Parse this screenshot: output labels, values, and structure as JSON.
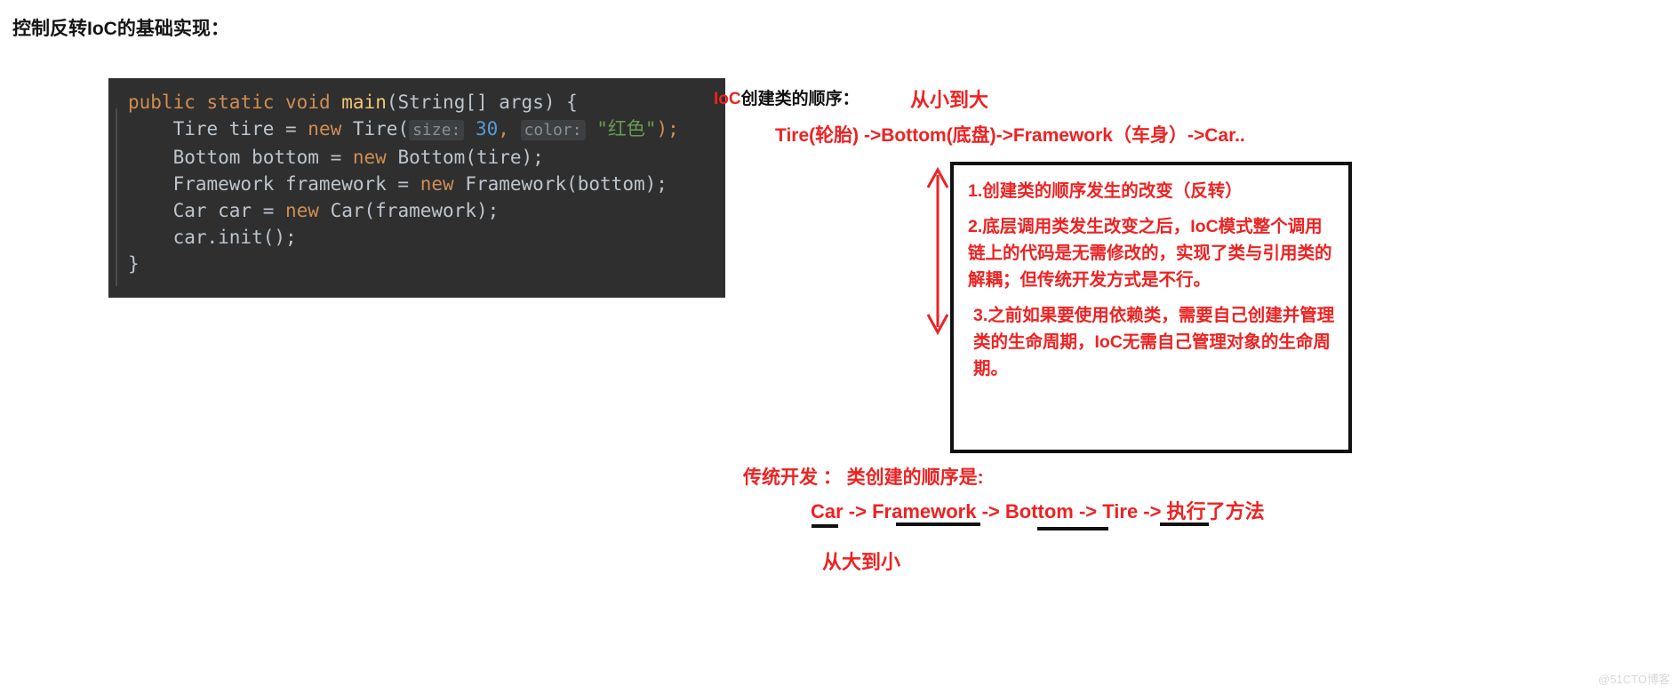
{
  "page": {
    "title": "控制反转IoC的基础实现：",
    "watermark": "@51CTO博客"
  },
  "code": {
    "lines": [
      "public static void main(String[] args) {",
      "    Tire tire = new Tire( size: 30,  color: \"红色\");",
      "    Bottom bottom = new Bottom(tire);",
      "    Framework framework = new Framework(bottom);",
      "    Car car = new Car(framework);",
      "    car.init();",
      "}"
    ],
    "tokens": {
      "l1_kw1": "public",
      "l1_kw2": "static",
      "l1_kw3": "void",
      "l1_method": "main",
      "l1_args": "(String[] args) {",
      "l2_type": "    Tire tire = ",
      "l2_new": "new",
      "l2_ctor": " Tire(",
      "l2_hint_size": "size:",
      "l2_num": "30",
      "l2_comma": ", ",
      "l2_hint_color": "color:",
      "l2_str": "\"红色\"",
      "l2_end": ");",
      "l3_type": "    Bottom bottom = ",
      "l3_new": "new",
      "l3_rest": " Bottom(tire);",
      "l4_type": "    Framework framework = ",
      "l4_new": "new",
      "l4_rest": " Framework(bottom);",
      "l5_type": "    Car car = ",
      "l5_new": "new",
      "l5_rest": " Car(framework);",
      "l6": "    car.init();",
      "l7": "}"
    },
    "colors": {
      "background": "#2f2f2f",
      "keyword": "#cf8e53",
      "method": "#f0c674",
      "plain": "#bcc5ce",
      "number": "#5b9ad5",
      "string": "#6a9b52",
      "hint_bg": "#3d3f41",
      "hint_text": "#878f99"
    }
  },
  "annotations": {
    "order_label_prefix": "IoC",
    "order_label_rest": "创建类的顺序：",
    "order_value": "从小到大",
    "ioc_chain": "Tire(轮胎) ->Bottom(底盘)->Framework（车身）->Car..",
    "notes": [
      "1.创建类的顺序发生的改变（反转）",
      "2.底层调用类发生改变之后，IoC模式整个调用链上的代码是无需修改的，实现了类与引用类的解耦；但传统开发方式是不行。",
      "3.之前如果要使用依赖类，需要自己创建并管理类的生命周期，IoC无需自己管理对象的生命周期。"
    ],
    "traditional_label": "传统开发 ： 类创建的顺序是:",
    "traditional_chain": "Car -> Framework -> Bottom -> Tire -> 执行了方法",
    "traditional_order": "从大到小",
    "accent_color": "#ee2222",
    "box_border_color": "#111111"
  }
}
